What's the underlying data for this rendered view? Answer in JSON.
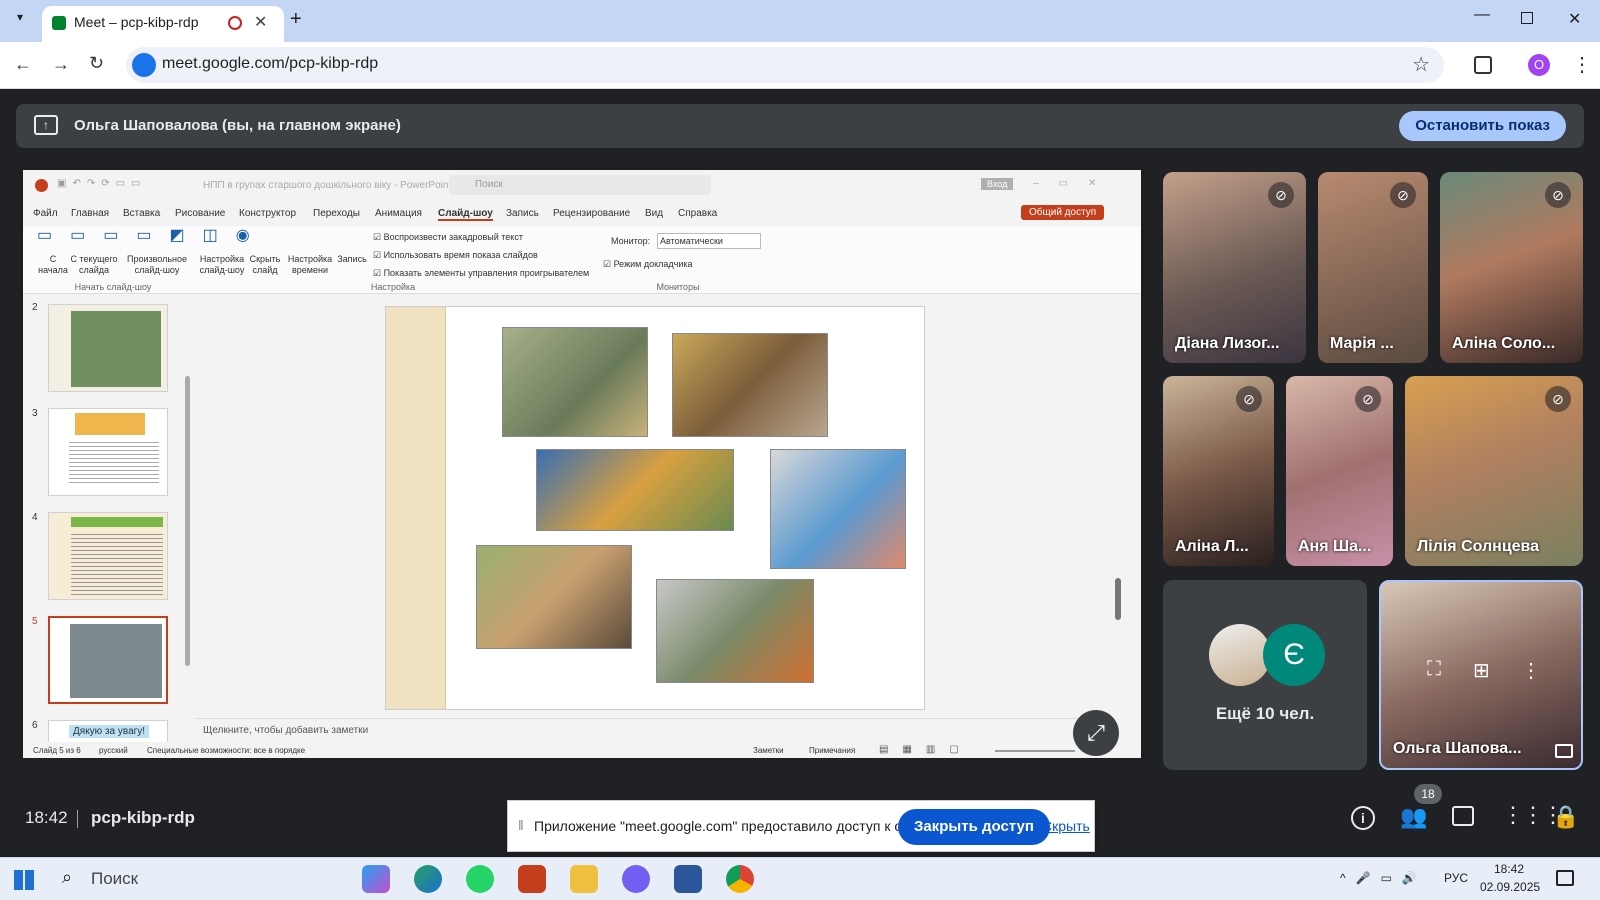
{
  "browser": {
    "tab_title": "Meet – pcp-kibp-rdp",
    "url": "meet.google.com/pcp-kibp-rdp",
    "profile_initial": "O"
  },
  "presenting": {
    "text": "Ольга Шаповалова (вы, на главном экране)",
    "stop_label": "Остановить показ"
  },
  "ppt": {
    "title": "НПП в групах старшого дошкільного віку  -  PowerPoint",
    "search": "Поиск",
    "signin": "Вход",
    "share_btn": "Общий доступ",
    "menu": [
      "Файл",
      "Главная",
      "Вставка",
      "Рисование",
      "Конструктор",
      "Переходы",
      "Анимация",
      "Слайд-шоу",
      "Запись",
      "Рецензирование",
      "Вид",
      "Справка"
    ],
    "ribbon": {
      "from_start": "С начала",
      "from_current": "С текущего слайда",
      "custom": "Произвольное слайд-шоу",
      "setup": "Настройка слайд-шоу",
      "hide": "Скрыть слайд",
      "timing": "Настройка времени",
      "record": "Запись",
      "cb1": "Воспроизвести закадровый текст",
      "cb2": "Использовать время показа слайдов",
      "cb3": "Показать элементы управления проигрывателем",
      "monitor_label": "Монитор:",
      "monitor_value": "Автоматически",
      "presenter": "Режим докладчика",
      "grp1": "Начать слайд-шоу",
      "grp2": "Настройка",
      "grp3": "Мониторы"
    },
    "thumbs": [
      {
        "num": "2"
      },
      {
        "num": "3"
      },
      {
        "num": "4"
      },
      {
        "num": "5"
      },
      {
        "num": "6",
        "text": "Дякую за увагу!"
      }
    ],
    "notes_placeholder": "Щелкните, чтобы добавить заметки",
    "status": {
      "slide": "Слайд 5 из 6",
      "lang": "русский",
      "access": "Специальные возможности: все в порядке",
      "notes": "Заметки",
      "comments": "Примечания"
    }
  },
  "participants": [
    {
      "name": "Діана Лизог..."
    },
    {
      "name": "Марія ..."
    },
    {
      "name": "Аліна Соло..."
    },
    {
      "name": "Аліна Л..."
    },
    {
      "name": "Аня Ша..."
    },
    {
      "name": "Лілія Солнцева"
    },
    {
      "name": "Ещё 10 чел.",
      "avatar_letter": "Є"
    },
    {
      "name": "Ольга Шапова..."
    }
  ],
  "meeting": {
    "time": "18:42",
    "code": "pcp-kibp-rdp",
    "people_count": "18"
  },
  "toast": {
    "text": "Приложение \"meet.google.com\" предоставило доступ к окну.",
    "close_label": "Закрыть доступ",
    "hide_label": "Скрыть"
  },
  "taskbar": {
    "search": "Поиск",
    "lang": "РУС",
    "time": "18:42",
    "date": "02.09.2025"
  },
  "colors": {
    "accent": "#a8c7fa",
    "ppt_red": "#c43e1c",
    "meet_bg": "#202124"
  }
}
